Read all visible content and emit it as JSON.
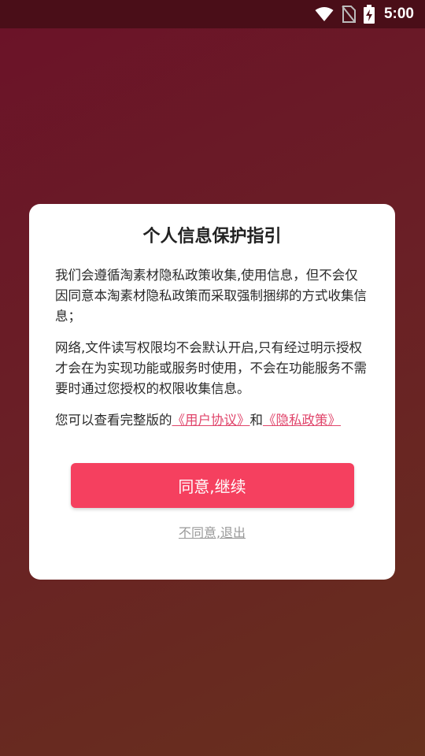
{
  "status_bar": {
    "time": "5:00",
    "icons": [
      "wifi-icon",
      "no-sim-icon",
      "battery-charging-icon"
    ]
  },
  "dialog": {
    "title": "个人信息保护指引",
    "paragraph1": "我们会遵循淘素材隐私政策收集,使用信息，但不会仅因同意本淘素材隐私政策而采取强制捆绑的方式收集信息；",
    "paragraph2": "网络,文件读写权限均不会默认开启,只有经过明示授权才会在为实现功能或服务时使用，不会在功能服务不需要时通过您授权的权限收集信息。",
    "paragraph3_prefix": "您可以查看完整版的",
    "user_agreement_link": "《用户协议》",
    "conjunction": "和",
    "privacy_policy_link": "《隐私政策》",
    "agree_button": "同意,继续",
    "disagree_link": "不同意,退出"
  },
  "colors": {
    "accent": "#f5405f",
    "link": "#e0456b",
    "background_top": "#6b1228",
    "background_bottom": "#67301d"
  }
}
